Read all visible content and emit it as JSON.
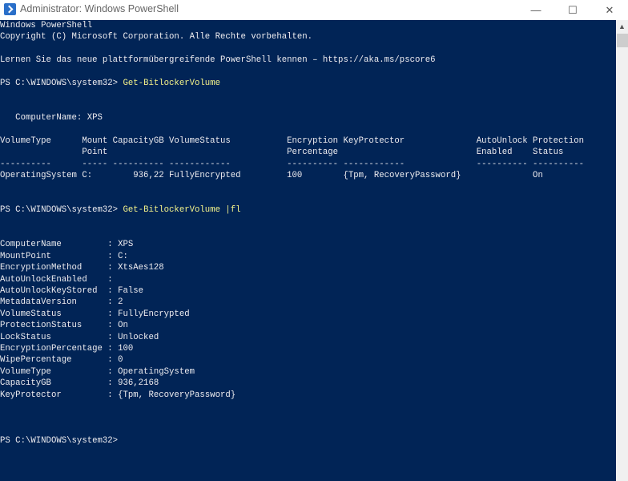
{
  "window": {
    "title": "Administrator: Windows PowerShell",
    "minimize_icon": "minimize-icon",
    "maximize_icon": "maximize-icon",
    "close_icon": "close-icon"
  },
  "colors": {
    "background": "#012456",
    "text": "#eeedf0",
    "command": "#f3f38a"
  },
  "console": {
    "lines": [
      {
        "text": "Windows PowerShell"
      },
      {
        "text": "Copyright (C) Microsoft Corporation. Alle Rechte vorbehalten."
      },
      {
        "text": ""
      },
      {
        "text": "Lernen Sie das neue plattformübergreifende PowerShell kennen – https://aka.ms/pscore6"
      },
      {
        "text": ""
      },
      {
        "text": "PS C:\\WINDOWS\\system32> ",
        "cmd": "Get-BitlockerVolume"
      },
      {
        "text": ""
      },
      {
        "text": ""
      },
      {
        "text": "   ComputerName: XPS"
      },
      {
        "text": ""
      },
      {
        "text": "VolumeType      Mount CapacityGB VolumeStatus           Encryption KeyProtector              AutoUnlock Protection"
      },
      {
        "text": "                Point                                   Percentage                           Enabled    Status"
      },
      {
        "text": "----------      ----- ---------- ------------           ---------- ------------              ---------- ----------"
      },
      {
        "text": "OperatingSystem C:        936,22 FullyEncrypted         100        {Tpm, RecoveryPassword}              On"
      },
      {
        "text": ""
      },
      {
        "text": ""
      },
      {
        "text": "PS C:\\WINDOWS\\system32> ",
        "cmd": "Get-BitlockerVolume |fl"
      },
      {
        "text": ""
      },
      {
        "text": ""
      },
      {
        "text": "ComputerName         : XPS"
      },
      {
        "text": "MountPoint           : C:"
      },
      {
        "text": "EncryptionMethod     : XtsAes128"
      },
      {
        "text": "AutoUnlockEnabled    :"
      },
      {
        "text": "AutoUnlockKeyStored  : False"
      },
      {
        "text": "MetadataVersion      : 2"
      },
      {
        "text": "VolumeStatus         : FullyEncrypted"
      },
      {
        "text": "ProtectionStatus     : On"
      },
      {
        "text": "LockStatus           : Unlocked"
      },
      {
        "text": "EncryptionPercentage : 100"
      },
      {
        "text": "WipePercentage       : 0"
      },
      {
        "text": "VolumeType           : OperatingSystem"
      },
      {
        "text": "CapacityGB           : 936,2168"
      },
      {
        "text": "KeyProtector         : {Tpm, RecoveryPassword}"
      },
      {
        "text": ""
      },
      {
        "text": ""
      },
      {
        "text": ""
      },
      {
        "text": "PS C:\\WINDOWS\\system32> "
      }
    ]
  }
}
